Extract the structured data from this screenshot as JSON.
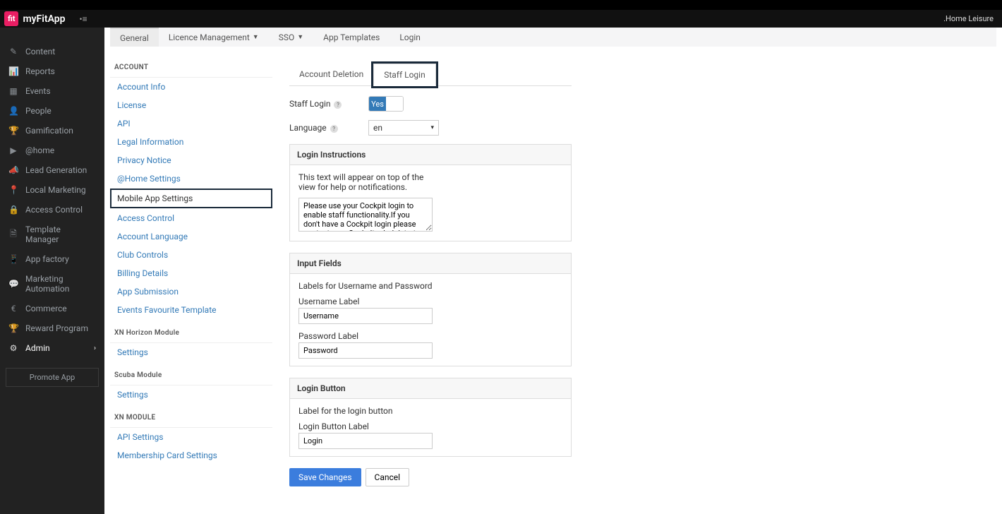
{
  "brand": {
    "logo_text": "fit",
    "name": "myFitApp"
  },
  "top_right": ".Home Leisure",
  "sidebar": {
    "items": [
      {
        "icon": "pencil",
        "label": "Content"
      },
      {
        "icon": "chart",
        "label": "Reports"
      },
      {
        "icon": "calendar",
        "label": "Events"
      },
      {
        "icon": "user",
        "label": "People"
      },
      {
        "icon": "trophy",
        "label": "Gamification"
      },
      {
        "icon": "play",
        "label": "@home"
      },
      {
        "icon": "bull",
        "label": "Lead Generation"
      },
      {
        "icon": "pin",
        "label": "Local Marketing"
      },
      {
        "icon": "lock",
        "label": "Access Control"
      },
      {
        "icon": "doc",
        "label": "Template Manager"
      },
      {
        "icon": "mobile",
        "label": "App factory"
      },
      {
        "icon": "comment",
        "label": "Marketing Automation"
      },
      {
        "icon": "euro",
        "label": "Commerce"
      },
      {
        "icon": "trophy",
        "label": "Reward Program"
      },
      {
        "icon": "gear",
        "label": "Admin",
        "active": true,
        "chevron": true
      }
    ],
    "promote": "Promote App"
  },
  "tabs": [
    {
      "label": "General",
      "active": true
    },
    {
      "label": "Licence Management",
      "caret": true
    },
    {
      "label": "SSO",
      "caret": true
    },
    {
      "label": "App Templates"
    },
    {
      "label": "Login"
    }
  ],
  "sidemenu": {
    "heading_account": "ACCOUNT",
    "links_account": [
      "Account Info",
      "License",
      "API",
      "Legal Information",
      "Privacy Notice",
      "@Home Settings",
      "Mobile App Settings",
      "Access Control",
      "Account Language",
      "Club Controls",
      "Billing Details",
      "App Submission",
      "Events Favourite Template"
    ],
    "highlight_account_index": 6,
    "heading_horizon": "XN Horizon Module",
    "links_horizon": [
      "Settings"
    ],
    "heading_scuba": "Scuba Module",
    "links_scuba": [
      "Settings"
    ],
    "heading_xn": "XN MODULE",
    "links_xn": [
      "API Settings",
      "Membership Card Settings"
    ]
  },
  "subtabs": [
    {
      "label": "Account Deletion"
    },
    {
      "label": "Staff Login",
      "active": true,
      "highlighted": true
    }
  ],
  "form": {
    "staff_login_label": "Staff Login",
    "staff_login_value": "Yes",
    "language_label": "Language",
    "language_value": "en",
    "panel1_title": "Login Instructions",
    "panel1_descr": "This text will appear on top of the view for help or notifications.",
    "panel1_textarea": "Please use your Cockpit login to enable staff functionality.If you don't have a Cockpit login please contact your Cockpit administrator to invite you.",
    "panel2_title": "Input Fields",
    "panel2_descr": "Labels for Username and Password",
    "username_label_label": "Username Label",
    "username_label_value": "Username",
    "password_label_label": "Password Label",
    "password_label_value": "Password",
    "panel3_title": "Login Button",
    "panel3_descr": "Label for the login button",
    "login_btn_label": "Login Button Label",
    "login_btn_value": "Login",
    "save_btn": "Save Changes",
    "cancel_btn": "Cancel"
  },
  "icons": {
    "pencil": "✎",
    "chart": "📊",
    "calendar": "▦",
    "user": "👤",
    "trophy": "🏆",
    "play": "▶",
    "bull": "📣",
    "pin": "📍",
    "lock": "🔒",
    "doc": "🗎",
    "mobile": "📱",
    "comment": "💬",
    "euro": "€",
    "gear": "⚙"
  }
}
